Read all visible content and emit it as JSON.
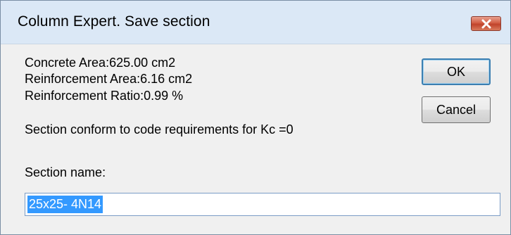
{
  "window": {
    "title": "Column Expert. Save section",
    "close_icon": "close-icon"
  },
  "info": {
    "concrete_area": "Concrete Area:625.00 cm2",
    "reinforcement_area": "Reinforcement Area:6.16 cm2",
    "reinforcement_ratio": "Reinforcement Ratio:0.99 %",
    "conformity": "Section conform to code requirements for Kc =0"
  },
  "buttons": {
    "ok_label": "OK",
    "cancel_label": "Cancel"
  },
  "section_name": {
    "label": "Section name:",
    "value": "25x25- 4N14"
  },
  "colors": {
    "titlebar": "#dbe8f6",
    "dialog_bg": "#f0f0f0",
    "close_button": "#c7432b",
    "selection": "#3399ff"
  }
}
